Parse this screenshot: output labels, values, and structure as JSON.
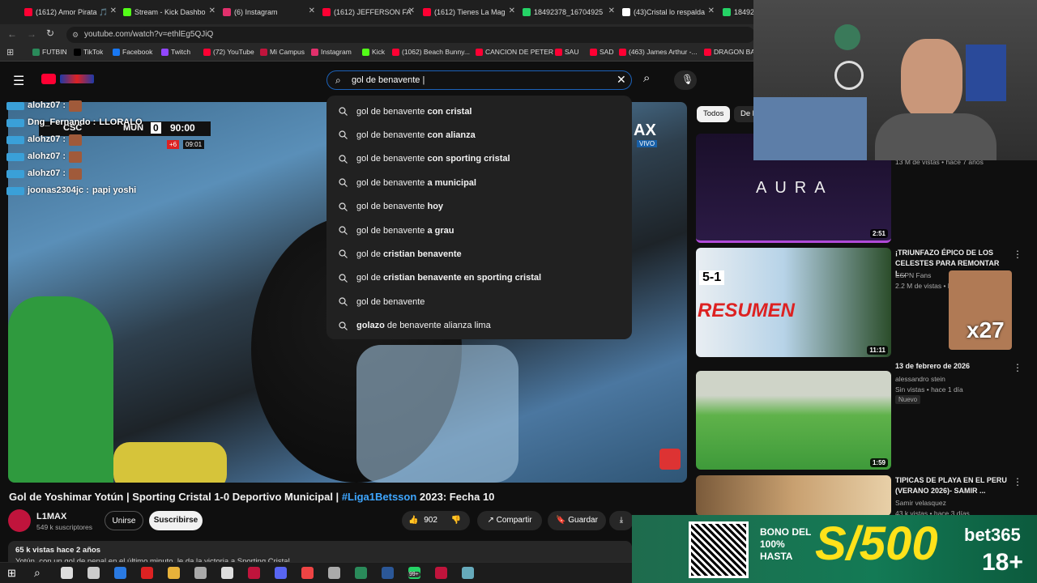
{
  "browser": {
    "tabs": [
      {
        "label": "(1612) Amor Pirata 🎵",
        "color": "#ff0033"
      },
      {
        "label": "Stream - Kick Dashbo",
        "color": "#53fc18"
      },
      {
        "label": "(6) Instagram",
        "color": "#e1306c"
      },
      {
        "label": "(1612) JEFFERSON FA",
        "color": "#ff0033"
      },
      {
        "label": "(1612) Tienes La Mag",
        "color": "#ff0033"
      },
      {
        "label": "18492378_16704925",
        "color": "#25d366"
      },
      {
        "label": "(43)Cristal lo respalda",
        "color": "#ffffff"
      },
      {
        "label": "18492",
        "color": "#25d366"
      }
    ],
    "url": "youtube.com/watch?v=ethlEg5QJiQ",
    "bookmarks": [
      "FUTBIN",
      "TikTok",
      "Facebook",
      "Twitch",
      "(72) YouTube",
      "Mi Campus",
      "Instagram",
      "Kick",
      "(1062) Beach Bunny...",
      "CANCION DE PETER",
      "SAU",
      "SAD",
      "(463) James Arthur -...",
      "DRAGON BAL"
    ]
  },
  "search": {
    "query": "gol de benavente |",
    "suggestions": [
      {
        "pre": "gol de benavente ",
        "suf": "con cristal"
      },
      {
        "pre": "gol de benavente ",
        "suf": "con alianza"
      },
      {
        "pre": "gol de benavente ",
        "suf": "con sporting cristal"
      },
      {
        "pre": "gol de benavente ",
        "suf": "a municipal"
      },
      {
        "pre": "gol de benavente ",
        "suf": "hoy"
      },
      {
        "pre": "gol de benavente ",
        "suf": "a grau"
      },
      {
        "pre": "gol de ",
        "suf": "cristian benavente"
      },
      {
        "pre": "gol de ",
        "suf": "cristian benavente en sporting cristal"
      },
      {
        "pre": "gol de benavente",
        "suf": ""
      },
      {
        "pre": "",
        "suf": "golazo",
        "post": " de benavente alianza lima"
      }
    ]
  },
  "chat": [
    {
      "user": "alohz07 :",
      "msg": ""
    },
    {
      "user": "Dng_Fernando :",
      "msg": "LLORALO"
    },
    {
      "user": "alohz07 :",
      "msg": ""
    },
    {
      "user": "alohz07 :",
      "msg": ""
    },
    {
      "user": "alohz07 :",
      "msg": ""
    },
    {
      "user": "joonas2304jc :",
      "msg": "papi yoshi"
    }
  ],
  "scoreboard": {
    "home": "CSC",
    "away": "MUN",
    "score": "0",
    "time": "90:00",
    "added": "+6",
    "extra": "09:01",
    "tag": "VIVO",
    "corner": "AX"
  },
  "video": {
    "title": "Gol de Yoshimar Yotún | Sporting Cristal 1-0 Deportivo Municipal | ",
    "hashtag": "#Liga1Betsson",
    "title_end": " 2023: Fecha 10",
    "channel": "L1MAX",
    "subscribers": "549 k suscriptores",
    "join": "Unirse",
    "subscribe": "Suscribirse",
    "likes": "902",
    "share": "Compartir",
    "save": "Guardar",
    "views": "65 k vistas  hace 2 años",
    "desc": "Yotún, con un gol de penal en el último minuto, le da la victoria a Sporting Cristal"
  },
  "sidebar": {
    "chips": [
      "Todos",
      "De l"
    ],
    "videos": [
      {
        "thumb_text": "AURA",
        "duration": "2:51",
        "title": "",
        "meta": "13 M de vistas • hace 7 años",
        "meta2": ""
      },
      {
        "thumb_text": "RESUMEN",
        "thumb_score": "5-1",
        "duration": "11:11",
        "title": "¡TRIUNFAZO ÉPICO DE LOS CELESTES PARA REMONTAR L...",
        "meta": "ESPN Fans",
        "meta2": "2.2 M de vistas • ha"
      },
      {
        "duration": "1:59",
        "title": "13 de febrero de 2026",
        "meta": "alessandro stein",
        "meta2": "Sin vistas • hace 1 día",
        "badge": "Nuevo"
      },
      {
        "duration": "",
        "title": "TIPICAS DE PLAYA EN EL PERU (VERANO 2026)- SAMIR ...",
        "meta": "Samir velasquez",
        "meta2": "43 k vistas • hace 3 días"
      }
    ],
    "overlay_emote": "x27"
  },
  "ad": {
    "line1": "BONO DEL",
    "line2": "100%",
    "line3": "HASTA",
    "amount": "S/500",
    "brand": "bet365",
    "age": "18+"
  },
  "taskbar": {
    "badge": "99+"
  }
}
